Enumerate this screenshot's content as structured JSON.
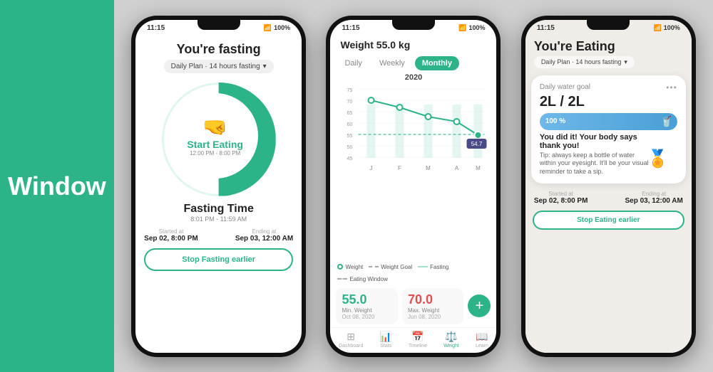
{
  "app": {
    "window_label": "Window"
  },
  "phone1": {
    "status_time": "11:15",
    "status_signal": "▲▼",
    "status_battery": "100%",
    "title": "You're fasting",
    "plan": "Daily Plan · 14 hours fasting",
    "circle_label": "Start Eating",
    "circle_time": "12:00 PM - 8:00 PM",
    "fasting_label": "Fasting Time",
    "fasting_time": "8:01 PM - 11:59 AM",
    "started_label": "Started at",
    "started_value": "Sep 02, 8:00 PM",
    "ending_label": "Ending at",
    "ending_value": "Sep 03, 12:00 AM",
    "stop_btn": "Stop Fasting earlier"
  },
  "phone2": {
    "status_time": "11:15",
    "status_battery": "100%",
    "chart_title": "Weight 55.0 kg",
    "tabs": [
      "Daily",
      "Weekly",
      "Monthly"
    ],
    "active_tab": "Monthly",
    "year_label": "2020",
    "y_labels": [
      "75",
      "70",
      "65",
      "60",
      "55",
      "50",
      "45"
    ],
    "x_labels": [
      "J",
      "F",
      "M",
      "A",
      "M"
    ],
    "legend": {
      "weight": "Weight",
      "weight_goal": "Weight Goal",
      "fasting": "Fasting",
      "eating_window": "Eating Window"
    },
    "last_value": "54.7",
    "stat1_value": "55.0",
    "stat1_label": "Min. Weight",
    "stat1_date": "Oct 08, 2020",
    "stat2_value": "70.0",
    "stat2_label": "Max. Weight",
    "stat2_date": "Jun 08, 2020",
    "nav_items": [
      "Dashboard",
      "Stats",
      "Timeline",
      "Weight",
      "Learn"
    ]
  },
  "phone3": {
    "status_time": "11:15",
    "status_battery": "100%",
    "title": "You're Eating",
    "plan": "Daily Plan · 14 hours fasting",
    "water_title": "Daily water goal",
    "water_amount": "2L / 2L",
    "progress_pct": "100 %",
    "success_text": "You did it! Your body says thank you!",
    "tip_text": "Tip: always keep a bottle of water within your eyesight. It'll be your visual reminder to take a sip.",
    "started_label": "Started at",
    "started_value": "Sep 02, 8:00 PM",
    "ending_label": "Ending at",
    "ending_value": "Sep 03, 12:00 AM",
    "stop_btn": "Stop Eating earlier"
  }
}
